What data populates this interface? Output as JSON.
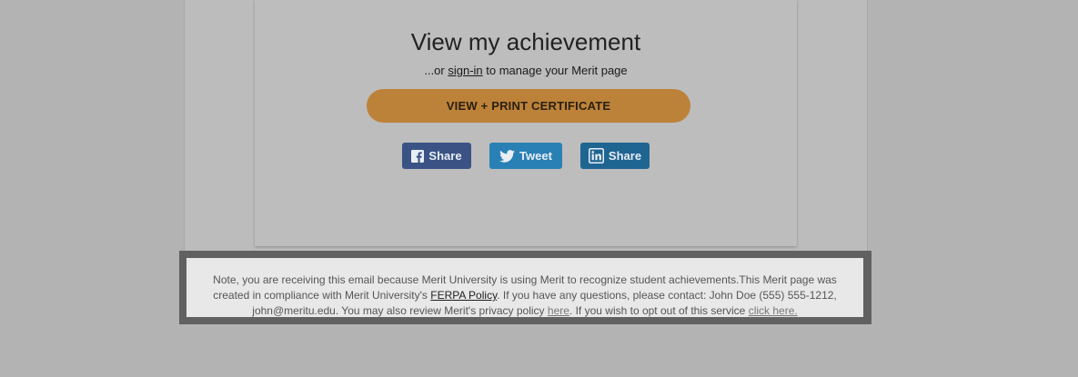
{
  "card": {
    "title": "View my achievement",
    "subtitle_prefix": "...or ",
    "signin_label": "sign-in",
    "subtitle_suffix": " to manage your Merit page",
    "cta_label": "VIEW + PRINT CERTIFICATE"
  },
  "social": {
    "facebook_label": "Share",
    "twitter_label": "Tweet",
    "linkedin_label": "Share"
  },
  "footer": {
    "text_1": "Note, you are receiving this email because Merit University is using Merit to recognize student achievements.This Merit page was created in compliance with Merit University's ",
    "ferpa_link": "FERPA Policy",
    "text_2": ". If you have any questions, please contact: John Doe (555) 555-1212, john@meritu.edu. You may also review Merit's privacy policy ",
    "privacy_link": "here",
    "text_3": ". If you wish to opt out of this service ",
    "optout_link": "click here."
  },
  "colors": {
    "page_bg": "#b3b3b3",
    "card_bg": "#bdbdbd",
    "cta_bg": "#bd8239",
    "facebook": "#3a5384",
    "twitter": "#2980b4",
    "linkedin": "#1f6592",
    "footer_frame": "#616161",
    "footer_bg": "#e8e8e8"
  },
  "icons": {
    "facebook": "facebook-icon",
    "twitter": "twitter-icon",
    "linkedin": "linkedin-icon"
  }
}
